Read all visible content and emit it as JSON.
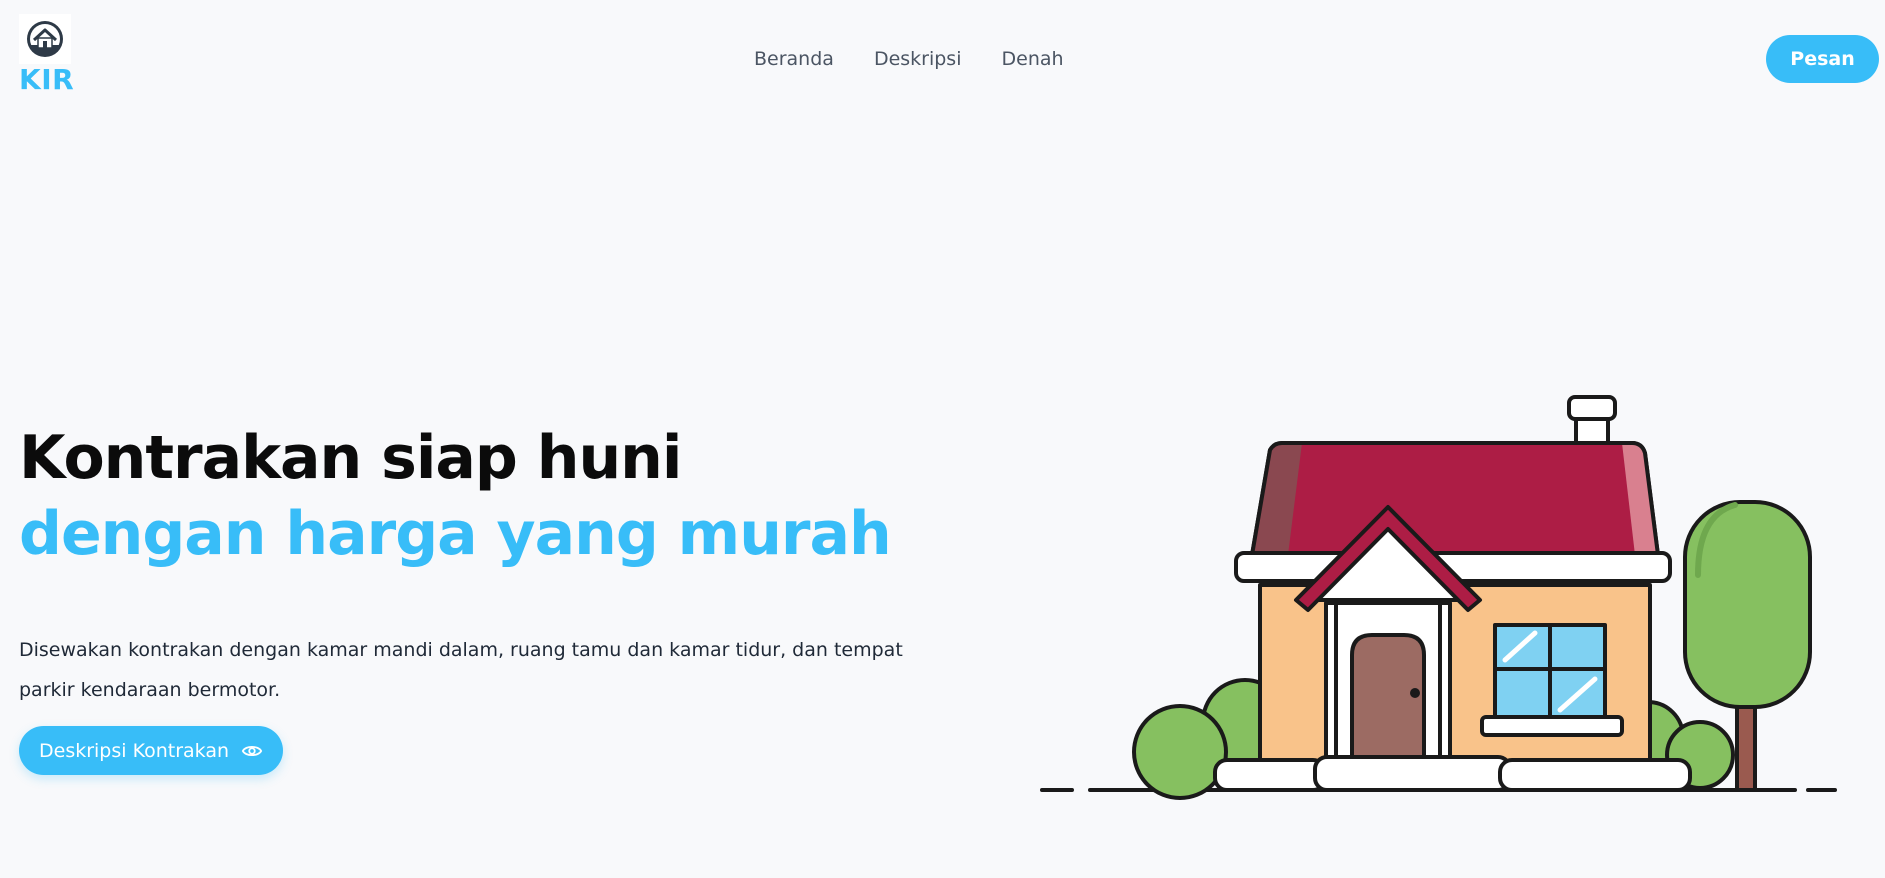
{
  "header": {
    "logo_text": "KIR",
    "logo_icon": "house-icon",
    "nav": [
      {
        "label": "Beranda"
      },
      {
        "label": "Deskripsi"
      },
      {
        "label": "Denah"
      }
    ],
    "cta_label": "Pesan"
  },
  "hero": {
    "title_plain": "Kontrakan siap huni ",
    "title_accent": "dengan harga yang murah",
    "description": "Disewakan kontrakan dengan kamar mandi dalam, ruang tamu dan kamar tidur, dan tempat parkir kendaraan bermotor.",
    "button_label": "Deskripsi Kontrakan",
    "button_icon": "eye-icon",
    "illustration": "house-illustration"
  },
  "colors": {
    "accent": "#38bdf8",
    "background": "#f8f9fb",
    "roof": "#ad1d45",
    "wall": "#f9c38a",
    "tree": "#86c060"
  }
}
